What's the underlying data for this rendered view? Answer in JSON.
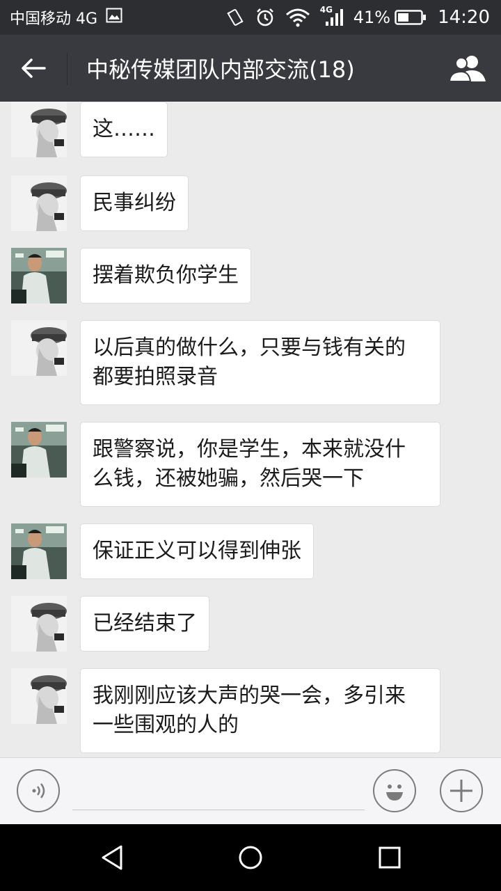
{
  "status_bar": {
    "carrier": "中国移动 4G",
    "network_label": "4G",
    "battery": "41%",
    "time": "14:20",
    "icons": [
      "image-icon",
      "vibrate-icon",
      "alarm-icon",
      "wifi-icon",
      "signal-icon",
      "battery-icon"
    ]
  },
  "header": {
    "title": "中秘传媒团队内部交流(18)",
    "back_icon": "back-arrow-icon",
    "members_icon": "group-members-icon"
  },
  "messages": [
    {
      "sender": "avatar-a",
      "text": "这……"
    },
    {
      "sender": "avatar-a",
      "text": "民事纠纷"
    },
    {
      "sender": "avatar-b",
      "text": "摆着欺负你学生"
    },
    {
      "sender": "avatar-a",
      "text": "以后真的做什么，只要与钱有关的\n都要拍照录音"
    },
    {
      "sender": "avatar-b",
      "text": "跟警察说，你是学生，本来就没什\n么钱，还被她骗，然后哭一下"
    },
    {
      "sender": "avatar-b",
      "text": "保证正义可以得到伸张"
    },
    {
      "sender": "avatar-a",
      "text": "已经结束了"
    },
    {
      "sender": "avatar-a",
      "text": "我刚刚应该大声的哭一会，多引来\n一些围观的人的"
    }
  ],
  "input_bar": {
    "voice_icon": "voice-icon",
    "input_value": "",
    "emoji_icon": "emoji-icon",
    "plus_icon": "plus-icon"
  },
  "system_nav": {
    "back_icon": "triangle-back-icon",
    "home_icon": "circle-home-icon",
    "recents_icon": "square-recents-icon"
  },
  "colors": {
    "status_bar_bg": "#2d2e32",
    "nav_bar_bg": "#393a3f",
    "chat_bg": "#ebebeb",
    "bubble_bg": "#ffffff",
    "input_bar_bg": "#f5f5f7"
  }
}
